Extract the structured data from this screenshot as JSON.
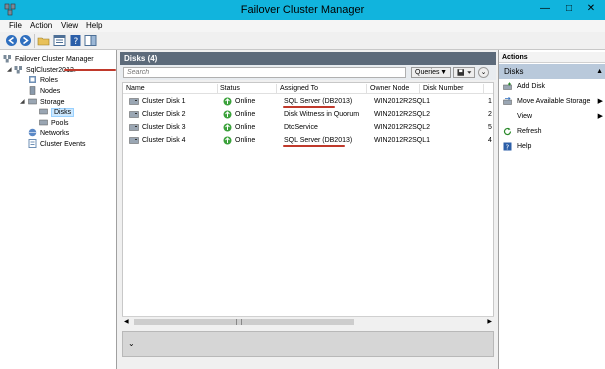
{
  "window": {
    "title": "Failover Cluster Manager",
    "minimize": "—",
    "maximize": "□",
    "close": "✕"
  },
  "menu": {
    "file": "File",
    "action": "Action",
    "view": "View",
    "help": "Help"
  },
  "tree": {
    "root": "Failover Cluster Manager",
    "cluster": "SqlCluster2012.",
    "roles": "Roles",
    "nodes": "Nodes",
    "storage": "Storage",
    "disks": "Disks",
    "pools": "Pools",
    "networks": "Networks",
    "cluster_events": "Cluster Events"
  },
  "center": {
    "header": "Disks (4)",
    "search_placeholder": "Search",
    "queries_label": "Queries",
    "columns": [
      "Name",
      "Status",
      "Assigned To",
      "Owner Node",
      "Disk Number"
    ],
    "rows": [
      {
        "name": "Cluster Disk 1",
        "status": "Online",
        "assigned": "SQL Server (DB2013)",
        "owner": "WIN2012R2SQL1",
        "disk": "1"
      },
      {
        "name": "Cluster Disk 2",
        "status": "Online",
        "assigned": "Disk Witness in Quorum",
        "owner": "WIN2012R2SQL2",
        "disk": "2"
      },
      {
        "name": "Cluster Disk 3",
        "status": "Online",
        "assigned": "DtcService",
        "owner": "WIN2012R2SQL2",
        "disk": "5"
      },
      {
        "name": "Cluster Disk 4",
        "status": "Online",
        "assigned": "SQL Server (DB2013)",
        "owner": "WIN2012R2SQL1",
        "disk": "4"
      }
    ]
  },
  "actions": {
    "title": "Actions",
    "section": "Disks",
    "items": [
      {
        "label": "Add Disk",
        "icon": "add-disk-icon"
      },
      {
        "label": "Move Available Storage",
        "icon": "move-storage-icon"
      },
      {
        "label": "View",
        "icon": "none"
      },
      {
        "label": "Refresh",
        "icon": "refresh-icon"
      },
      {
        "label": "Help",
        "icon": "help-icon"
      }
    ]
  },
  "colors": {
    "titlebar": "#11b4dd",
    "pane_header": "#5c6a7a",
    "actions_section": "#b9c9db",
    "online_green": "#3aa13a",
    "annotation_red": "#c0392b"
  }
}
